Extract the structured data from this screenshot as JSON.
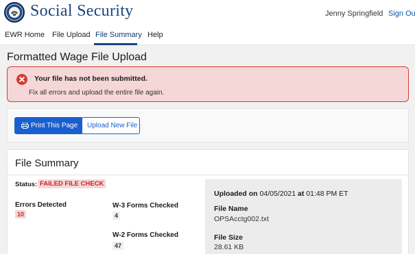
{
  "header": {
    "brand": "Social Security",
    "logo_icon": "ssa-seal-icon",
    "user_name": "Jenny Springfield",
    "sign_out": "Sign Out"
  },
  "nav": {
    "items": [
      {
        "label": "EWR Home"
      },
      {
        "label": "File Upload"
      },
      {
        "label": "File Summary",
        "active": true
      },
      {
        "label": "Help"
      }
    ]
  },
  "page": {
    "title": "Formatted Wage File Upload"
  },
  "alert": {
    "icon": "error-circle-icon",
    "heading": "Your file has not been submitted.",
    "body": "Fix all errors and upload the entire file again."
  },
  "actions": {
    "print_label": "Print This Page",
    "print_icon": "printer-icon",
    "upload_label": "Upload New File"
  },
  "summary": {
    "title": "File Summary",
    "status_label": "Status:",
    "status_value": "FAILED FILE CHECK",
    "errors_label": "Errors Detected",
    "errors_value": "10",
    "w3_label": "W-3 Forms Checked",
    "w3_value": "4",
    "w2_label": "W-2 Forms Checked",
    "w2_value": "47",
    "uploaded_on_label": "Uploaded on",
    "uploaded_date": "04/05/2021",
    "at_label": "at",
    "uploaded_time": "01:48 PM ET",
    "file_name_label": "File Name",
    "file_name": "OPSAcctg002.txt",
    "file_size_label": "File Size",
    "file_size": "28.61 KB"
  },
  "colors": {
    "brand": "#1a4480",
    "primary_button": "#1a5fcf",
    "error": "#d83933",
    "error_bg": "#f5d7d7"
  }
}
